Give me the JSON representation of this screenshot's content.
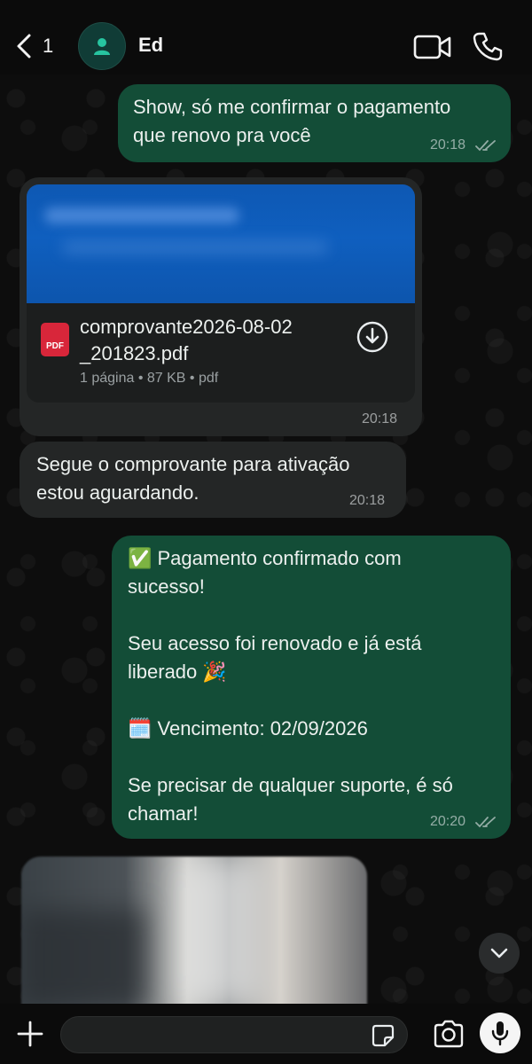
{
  "header": {
    "back_count": "1",
    "contact_name": "Ed"
  },
  "messages": [
    {
      "direction": "outgoing",
      "text": "Show, só me confirmar o pagamento\nque renovo pra você",
      "time": "20:18",
      "status": "read"
    },
    {
      "direction": "incoming",
      "type": "document",
      "file_name": "comprovante2026-08-02\n_201823.pdf",
      "file_meta": "1 página • 87 KB • pdf",
      "file_type_label": "PDF",
      "time": "20:18"
    },
    {
      "direction": "incoming",
      "text": "Segue o comprovante para ativação\nestou aguardando.",
      "time": "20:18"
    },
    {
      "direction": "outgoing",
      "text": "✅ Pagamento confirmado com\nsucesso!\n\nSeu acesso foi renovado e já está\nliberado 🎉\n\n🗓️ Vencimento: 02/09/2026\n\nSe precisar de qualquer suporte, é só\nchamar!",
      "time": "20:20",
      "status": "read"
    },
    {
      "direction": "incoming",
      "type": "image"
    }
  ],
  "composer": {
    "placeholder": ""
  },
  "colors": {
    "outgoing_bubble": "#134d37",
    "incoming_bubble": "#242626",
    "background": "#0b0b0b"
  }
}
